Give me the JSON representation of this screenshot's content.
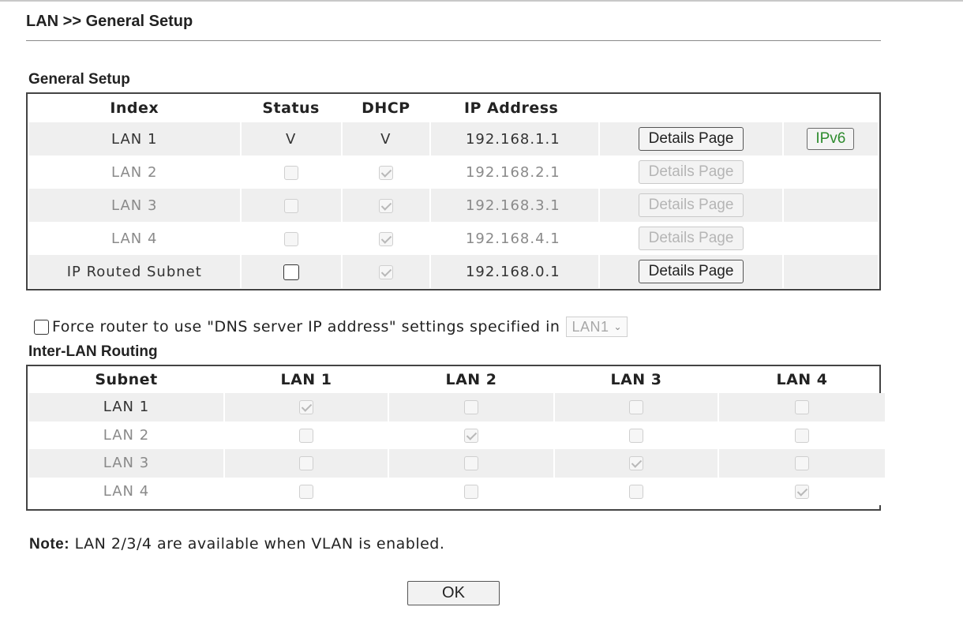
{
  "page": {
    "title": "LAN >> General Setup"
  },
  "general_setup": {
    "title": "General Setup",
    "headers": [
      "Index",
      "Status",
      "DHCP",
      "IP Address"
    ],
    "rows": [
      {
        "index": "LAN 1",
        "status": "V",
        "dhcp": "V",
        "ip": "192.168.1.1",
        "details_label": "Details Page",
        "details_enabled": true,
        "ipv6_label": "IPv6"
      },
      {
        "index": "LAN 2",
        "status_checked": false,
        "dhcp_checked": true,
        "ip": "192.168.2.1",
        "details_label": "Details Page",
        "details_enabled": false
      },
      {
        "index": "LAN 3",
        "status_checked": false,
        "dhcp_checked": true,
        "ip": "192.168.3.1",
        "details_label": "Details Page",
        "details_enabled": false
      },
      {
        "index": "LAN 4",
        "status_checked": false,
        "dhcp_checked": true,
        "ip": "192.168.4.1",
        "details_label": "Details Page",
        "details_enabled": false
      },
      {
        "index": "IP Routed Subnet",
        "status_checked": false,
        "dhcp_checked": true,
        "ip": "192.168.0.1",
        "details_label": "Details Page",
        "details_enabled": true
      }
    ]
  },
  "dns": {
    "label": "Force router to use \"DNS server IP address\" settings specified in",
    "checked": false,
    "selected": "LAN1"
  },
  "inter_lan": {
    "title": "Inter-LAN Routing",
    "headers": [
      "Subnet",
      "LAN 1",
      "LAN 2",
      "LAN 3",
      "LAN 4"
    ],
    "rows": [
      {
        "label": "LAN 1",
        "checks": [
          true,
          false,
          false,
          false
        ]
      },
      {
        "label": "LAN 2",
        "checks": [
          false,
          true,
          false,
          false
        ]
      },
      {
        "label": "LAN 3",
        "checks": [
          false,
          false,
          true,
          false
        ]
      },
      {
        "label": "LAN 4",
        "checks": [
          false,
          false,
          false,
          true
        ]
      }
    ]
  },
  "note": {
    "label": "Note:",
    "text": "LAN 2/3/4 are available when VLAN is enabled."
  },
  "ok_button": "OK",
  "colors": {
    "ipv6_text": "#2e8b2e",
    "row_shade": "#efefef",
    "disabled_text": "#b5b5b5"
  }
}
